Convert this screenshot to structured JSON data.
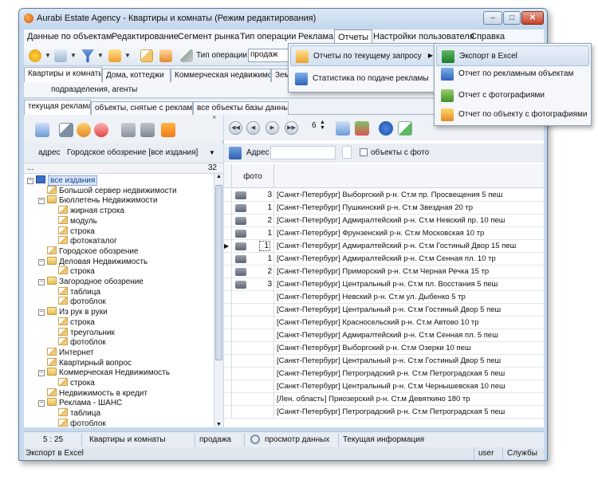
{
  "window": {
    "title": "Aurabi Estate Agency - Квартиры и комнаты (Режим редактирования)",
    "controls": [
      "–",
      "□",
      "✕"
    ]
  },
  "menubar": {
    "items": [
      "Данные по объектам",
      "Редактирование",
      "Сегмент рынка",
      "Тип операции",
      "Реклама",
      "Отчеты",
      "Настройки пользователя",
      "Справка"
    ],
    "active": "Отчеты"
  },
  "toolbar": {
    "operation_label": "Тип операции",
    "operation_value": "продаж"
  },
  "section_tabs": [
    "Квартиры и комнаты",
    "Дома, коттеджи",
    "Коммерческая недвижимость",
    "Зем"
  ],
  "subbar_text": "подразделения, агенты",
  "ad_tabs": [
    "текущая реклама",
    "объекты, снятые с рекламы",
    "все объекты базы данных"
  ],
  "left_panel": {
    "filter_label": "адрес",
    "filter_value": "Городское обозрение  [все издания]",
    "header_left": "...",
    "header_count": "32",
    "tree": [
      {
        "label": "все издания",
        "level": 0,
        "type": "all",
        "expander": "−",
        "selected": true
      },
      {
        "label": "Большой сервер недвижимости",
        "level": 1,
        "type": "leaf"
      },
      {
        "label": "Бюллетень Недвижимости",
        "level": 1,
        "type": "folder",
        "expander": "−"
      },
      {
        "label": "жирная строка",
        "level": 2,
        "type": "leaf"
      },
      {
        "label": "модуль",
        "level": 2,
        "type": "leaf"
      },
      {
        "label": "строка",
        "level": 2,
        "type": "leaf"
      },
      {
        "label": "фотокаталог",
        "level": 2,
        "type": "leaf"
      },
      {
        "label": "Городское обозрение",
        "level": 1,
        "type": "leaf"
      },
      {
        "label": "Деловая Недвижимость",
        "level": 1,
        "type": "folder",
        "expander": "−"
      },
      {
        "label": "строка",
        "level": 2,
        "type": "leaf"
      },
      {
        "label": "Загородное обозрение",
        "level": 1,
        "type": "folder",
        "expander": "−"
      },
      {
        "label": "таблица",
        "level": 2,
        "type": "leaf"
      },
      {
        "label": "фотоблок",
        "level": 2,
        "type": "leaf"
      },
      {
        "label": "Из рук в руки",
        "level": 1,
        "type": "folder",
        "expander": "−"
      },
      {
        "label": "строка",
        "level": 2,
        "type": "leaf"
      },
      {
        "label": "треугольник",
        "level": 2,
        "type": "leaf"
      },
      {
        "label": "фотоблок",
        "level": 2,
        "type": "leaf"
      },
      {
        "label": "Интернет",
        "level": 1,
        "type": "leaf"
      },
      {
        "label": "Квартирный вопрос",
        "level": 1,
        "type": "leaf"
      },
      {
        "label": "Коммерческая Недвижимость",
        "level": 1,
        "type": "folder",
        "expander": "−"
      },
      {
        "label": "строка",
        "level": 2,
        "type": "leaf"
      },
      {
        "label": "Недвижимость в кредит",
        "level": 1,
        "type": "leaf"
      },
      {
        "label": "Реклама - ШАНС",
        "level": 1,
        "type": "folder",
        "expander": "−"
      },
      {
        "label": "таблица",
        "level": 2,
        "type": "leaf"
      },
      {
        "label": "фотоблок",
        "level": 2,
        "type": "leaf"
      }
    ]
  },
  "right_panel": {
    "page_value": "6",
    "search_label": "Адрес",
    "checkbox_label": "объекты с фото",
    "photo_header": "фото",
    "rows": [
      {
        "photo": true,
        "count": "3",
        "address": "[Санкт-Петербург] Выборгский р-н. Ст.м пр. Просвещения 5 пеш"
      },
      {
        "photo": true,
        "count": "1",
        "address": "[Санкт-Петербург] Пушкинский р-н. Ст.м Звездная 20 тр"
      },
      {
        "photo": true,
        "count": "2",
        "address": "[Санкт-Петербург] Адмиралтейский р-н. Ст.м Невский пр. 10 пеш"
      },
      {
        "photo": true,
        "count": "1",
        "address": "[Санкт-Петербург] Фрунзенский р-н. Ст.м Московская 10 тр"
      },
      {
        "photo": true,
        "count": "1",
        "address": "[Санкт-Петербург] Адмиралтейский р-н. Ст.м Гостиный Двор 15 пеш",
        "current": true
      },
      {
        "photo": true,
        "count": "1",
        "address": "[Санкт-Петербург] Адмиралтейский р-н. Ст.м Сенная пл. 10 тр"
      },
      {
        "photo": true,
        "count": "2",
        "address": "[Санкт-Петербург] Приморский р-н. Ст.м Черная Речка 15 тр"
      },
      {
        "photo": true,
        "count": "3",
        "address": "[Санкт-Петербург] Центральный р-н. Ст.м пл. Восстания 5 пеш"
      },
      {
        "photo": false,
        "count": "",
        "address": "[Санкт-Петербург] Невский р-н. Ст.м ул. Дыбенко 5 тр"
      },
      {
        "photo": false,
        "count": "",
        "address": "[Санкт-Петербург] Центральный р-н. Ст.м Гостиный Двор 5 пеш"
      },
      {
        "photo": false,
        "count": "",
        "address": "[Санкт-Петербург] Красносельский р-н. Ст.м Автово 10 тр"
      },
      {
        "photo": false,
        "count": "",
        "address": "[Санкт-Петербург] Адмиралтейский р-н. Ст.м Сенная пл. 5 пеш"
      },
      {
        "photo": false,
        "count": "",
        "address": "[Санкт-Петербург] Выборгский р-н. Ст.м Озерки 10 пеш"
      },
      {
        "photo": false,
        "count": "",
        "address": "[Санкт-Петербург] Центральный р-н. Ст.м Гостиный Двор 5 пеш"
      },
      {
        "photo": false,
        "count": "",
        "address": "[Санкт-Петербург] Петроградский р-н. Ст.м Петроградская 5 пеш"
      },
      {
        "photo": false,
        "count": "",
        "address": "[Санкт-Петербург] Центральный р-н. Ст.м Чернышевская 10 пеш"
      },
      {
        "photo": false,
        "count": "",
        "address": "[Лен. область] Приозерский р-н. Ст.м Девяткино 180 тр"
      },
      {
        "photo": false,
        "count": "",
        "address": "[Санкт-Петербург] Петроградский р-н. Ст.м Петроградская 5 пеш"
      }
    ]
  },
  "reports_menu": {
    "items": [
      {
        "label": "Отчеты по текущему запросу",
        "has_submenu": true,
        "highlighted": true
      },
      {
        "label": "Статистика по подаче рекламы",
        "has_submenu": false
      }
    ]
  },
  "submenu": {
    "items": [
      {
        "label": "Экспорт в Excel",
        "highlighted": true
      },
      {
        "label": "Отчет по рекламным объектам"
      },
      {
        "label": "Отчет с фотографиями"
      },
      {
        "label": "Отчет по объекту с фотографиями"
      }
    ]
  },
  "statusbar": {
    "time": "5 : 25",
    "section": "Квартиры и комнаты",
    "operation": "продажа",
    "mode": "просмотр данных",
    "info": "Текущая информация"
  },
  "bottombar": {
    "hint": "Экспорт в Excel",
    "user": "user",
    "services": "Службы"
  },
  "colors": {
    "window_frame": "#c7d9ed",
    "selection_blue": "#3b6fc5",
    "close_button": "#c8412a"
  }
}
